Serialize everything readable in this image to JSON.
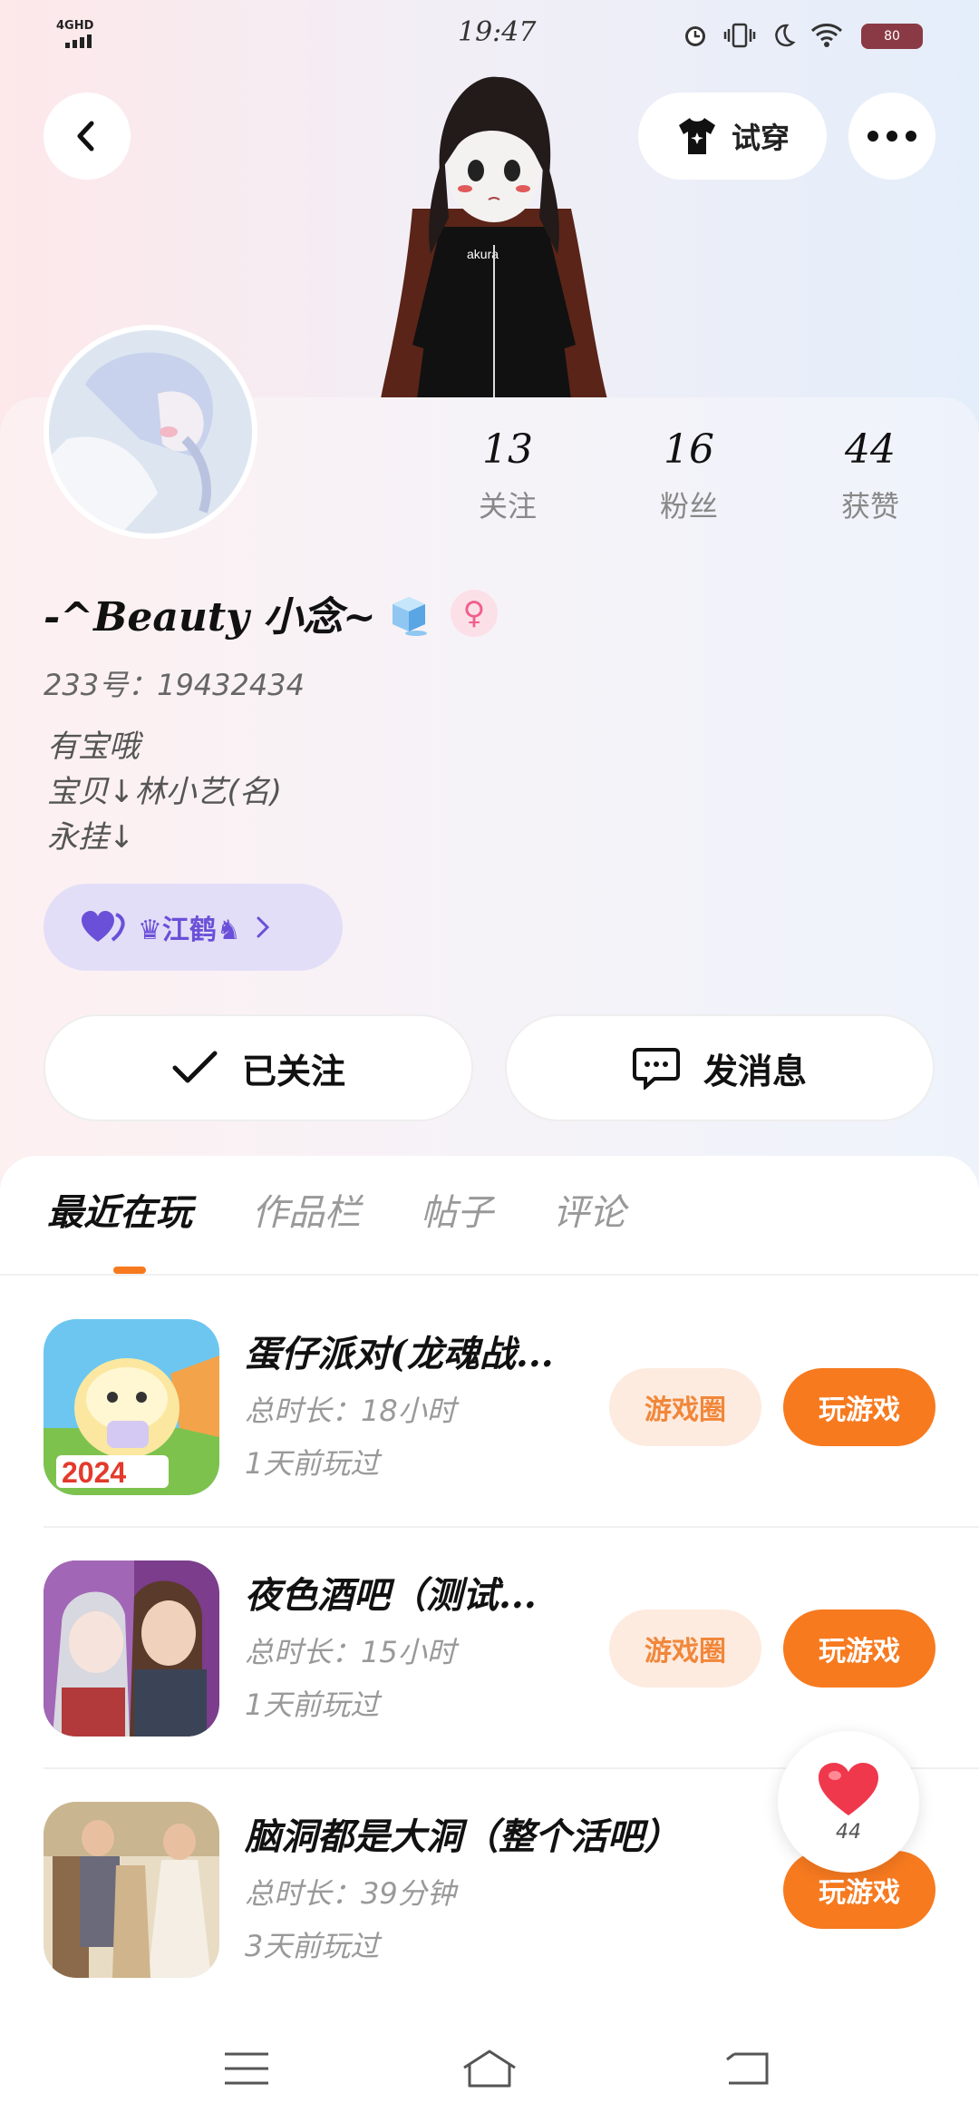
{
  "status_bar": {
    "network": "4GHD",
    "time": "19:47",
    "battery": "80"
  },
  "header": {
    "try_on_label": "试穿",
    "back_icon": "chevron-left-icon",
    "more_icon": "more-dots-icon"
  },
  "profile": {
    "stats": [
      {
        "value": "13",
        "label": "关注"
      },
      {
        "value": "16",
        "label": "粉丝"
      },
      {
        "value": "44",
        "label": "获赞"
      }
    ],
    "name": "-^Beauty 小念~",
    "gender_symbol": "♀",
    "uid": "233号：19432434",
    "bio": "有宝哦\n宝贝↓林小艺(名)\n永挂↓",
    "badge_label": "♛江鹤♞",
    "follow_label": "已关注",
    "message_label": "发消息"
  },
  "tabs": [
    {
      "label": "最近在玩",
      "active": true
    },
    {
      "label": "作品栏",
      "active": false
    },
    {
      "label": "帖子",
      "active": false
    },
    {
      "label": "评论",
      "active": false
    }
  ],
  "games": [
    {
      "title": "蛋仔派对(龙魂战...",
      "duration": "总时长：18小时",
      "last_played": "1天前玩过",
      "circle_label": "游戏圈",
      "play_label": "玩游戏",
      "icon_text": "2024"
    },
    {
      "title": "夜色酒吧（测试...",
      "duration": "总时长：15小时",
      "last_played": "1天前玩过",
      "circle_label": "游戏圈",
      "play_label": "玩游戏"
    },
    {
      "title": "脑洞都是大洞（整个活吧）",
      "duration": "总时长：39分钟",
      "last_played": "3天前玩过",
      "play_label": "玩游戏"
    }
  ],
  "like_float": {
    "count": "44"
  },
  "colors": {
    "accent": "#f77a1f",
    "badge_bg": "#e3def8",
    "badge_text": "#6a50d8"
  }
}
